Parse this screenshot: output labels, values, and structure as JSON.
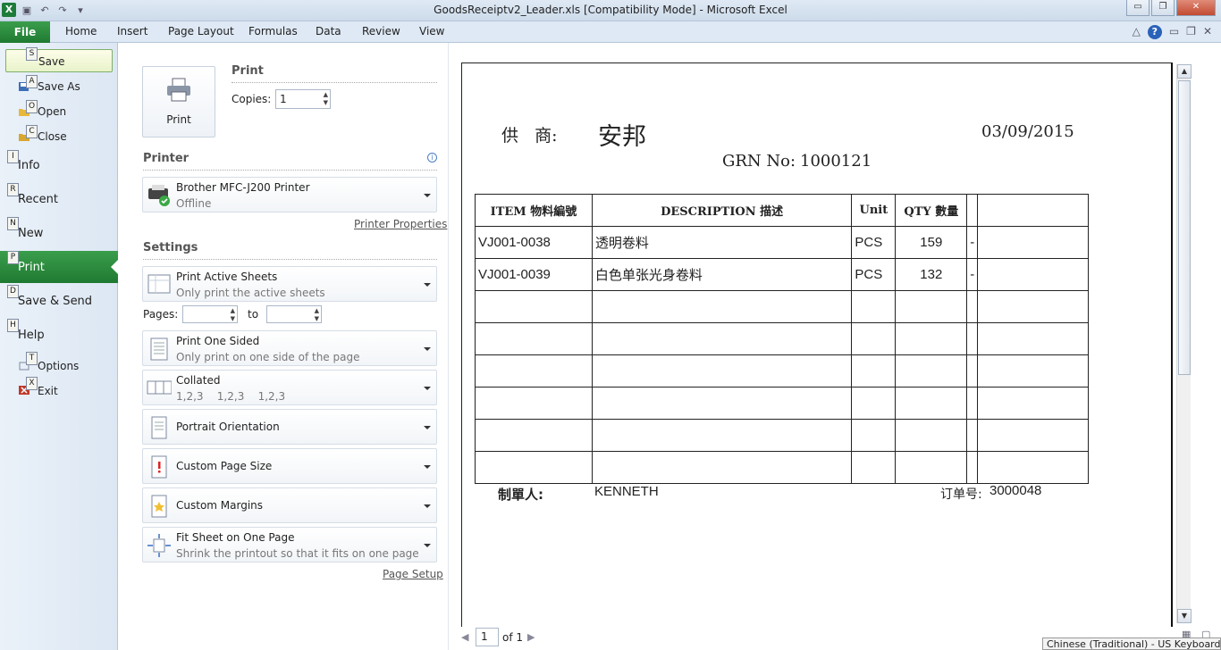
{
  "window": {
    "title": "GoodsReceiptv2_Leader.xls  [Compatibility Mode]  -  Microsoft Excel",
    "minimize": "▭",
    "restore": "❐",
    "close": "✕"
  },
  "ribbon": {
    "file": "File",
    "tabs": [
      "Home",
      "Insert",
      "Page Layout",
      "Formulas",
      "Data",
      "Review",
      "View"
    ]
  },
  "backstage": {
    "save": {
      "key": "S",
      "label": "Save"
    },
    "save_as": {
      "key": "A",
      "label": "Save As"
    },
    "open": {
      "key": "O",
      "label": "Open"
    },
    "close": {
      "key": "C",
      "label": "Close"
    },
    "info": {
      "key": "I",
      "label": "Info"
    },
    "recent": {
      "key": "R",
      "label": "Recent"
    },
    "new": {
      "key": "N",
      "label": "New"
    },
    "print": {
      "key": "P",
      "label": "Print"
    },
    "save_send": {
      "key": "D",
      "label": "Save & Send"
    },
    "help": {
      "key": "H",
      "label": "Help"
    },
    "options": {
      "key": "T",
      "label": "Options"
    },
    "exit": {
      "key": "X",
      "label": "Exit"
    }
  },
  "print_panel": {
    "print_button": "Print",
    "print_heading": "Print",
    "copies_label": "Copies:",
    "copies_value": "1",
    "printer_heading": "Printer",
    "printer_name": "Brother MFC-J200 Printer",
    "printer_status": "Offline",
    "printer_properties": "Printer Properties",
    "settings_heading": "Settings",
    "sheets_title": "Print Active Sheets",
    "sheets_sub": "Only print the active sheets",
    "pages_label": "Pages:",
    "to_label": "to",
    "sided_title": "Print One Sided",
    "sided_sub": "Only print on one side of the page",
    "collated_title": "Collated",
    "collated_sub": "1,2,3    1,2,3    1,2,3",
    "orientation_title": "Portrait Orientation",
    "size_title": "Custom Page Size",
    "margins_title": "Custom Margins",
    "scaling_title": "Fit Sheet on One Page",
    "scaling_sub": "Shrink the printout so that it fits on one page",
    "page_setup": "Page Setup"
  },
  "sheet": {
    "supplier_label": "供   商:",
    "supplier_value": "安邦",
    "date": "03/09/2015",
    "grn_label": "GRN No:",
    "grn_value": "1000121",
    "headers": [
      "ITEM 物料編號",
      "DESCRIPTION    描述",
      "Unit",
      "QTY 數量",
      "",
      ""
    ],
    "rows": [
      [
        "VJ001-0038",
        "透明卷料",
        "PCS",
        "159",
        "-",
        ""
      ],
      [
        "VJ001-0039",
        "白色单张光身卷料",
        "PCS",
        "132",
        "-",
        ""
      ],
      [
        "",
        "",
        "",
        "",
        "",
        ""
      ],
      [
        "",
        "",
        "",
        "",
        "",
        ""
      ],
      [
        "",
        "",
        "",
        "",
        "",
        ""
      ],
      [
        "",
        "",
        "",
        "",
        "",
        ""
      ],
      [
        "",
        "",
        "",
        "",
        "",
        ""
      ],
      [
        "",
        "",
        "",
        "",
        "",
        ""
      ]
    ],
    "maker_label": "制單人:",
    "maker_value": "KENNETH",
    "order_label": "订单号:",
    "order_value": "3000048"
  },
  "pager": {
    "current": "1",
    "of_label": "of 1"
  },
  "status": {
    "language": "Chinese (Traditional) - US Keyboard"
  }
}
